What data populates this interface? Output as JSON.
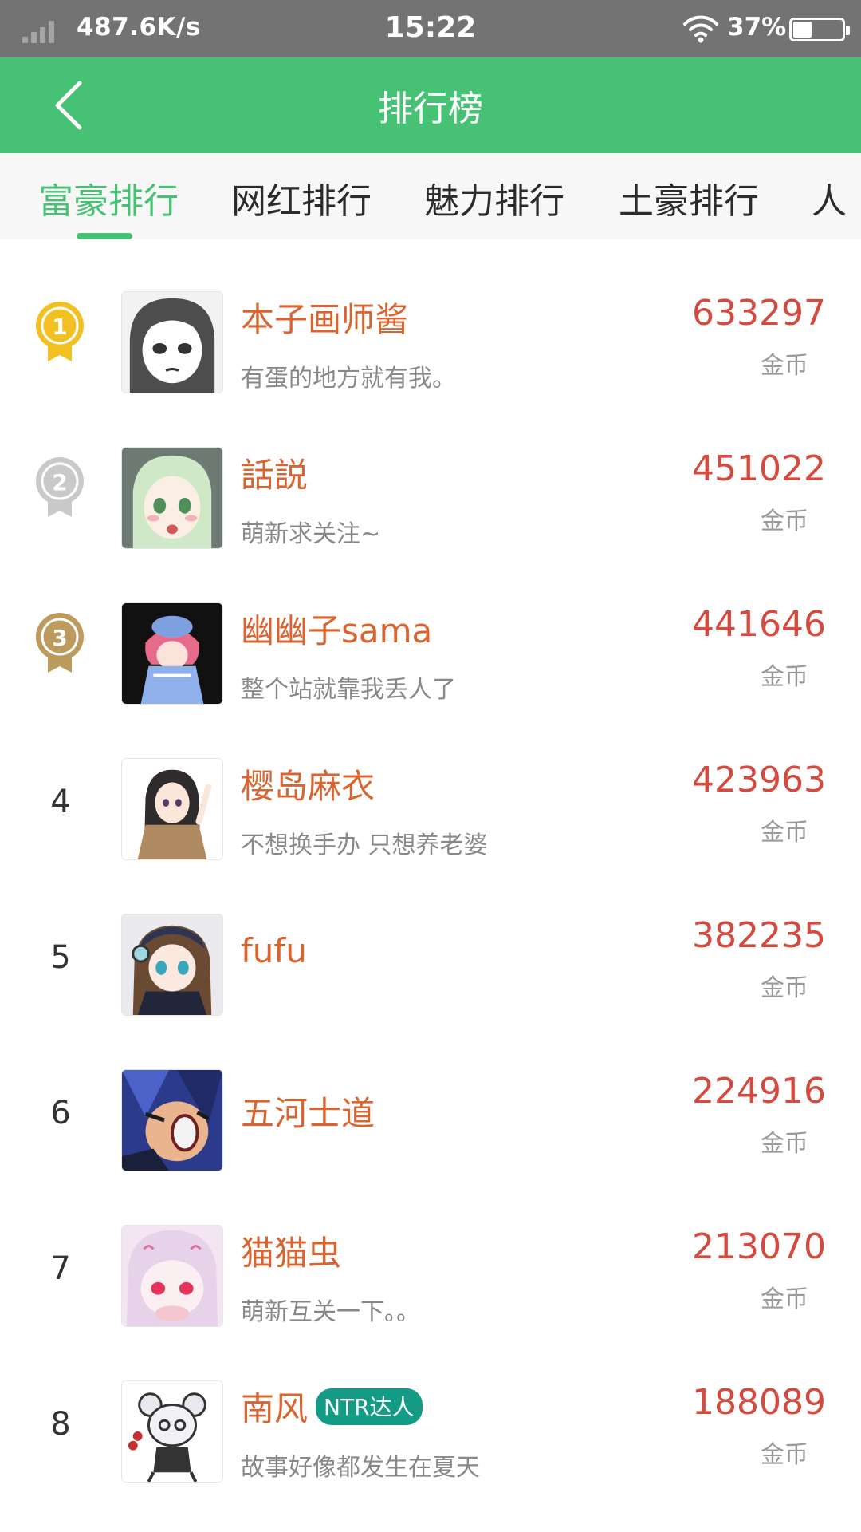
{
  "status_bar": {
    "net_speed": "487.6K/s",
    "time": "15:22",
    "battery": "37%"
  },
  "app_bar": {
    "back_icon": "chevron-left-icon",
    "title": "排行榜"
  },
  "tabs": [
    {
      "label": "富豪排行",
      "active": true
    },
    {
      "label": "网红排行",
      "active": false
    },
    {
      "label": "魅力排行",
      "active": false
    },
    {
      "label": "土豪排行",
      "active": false
    },
    {
      "label": "人",
      "active": false
    }
  ],
  "colors": {
    "primary": "#47c274",
    "name": "#d9642f",
    "coins": "#d44a3f",
    "gold": "#f2c022",
    "silver": "#c9c9c9",
    "bronze": "#bd9a5e",
    "badge": "#149b85"
  },
  "rankings": [
    {
      "rank": "1",
      "medal": "gold",
      "name": "本子画师酱",
      "badge": "",
      "motto": "有蛋的地方就有我。",
      "coins": "633297",
      "unit": "金币"
    },
    {
      "rank": "2",
      "medal": "silver",
      "name": "話説",
      "badge": "",
      "motto": "萌新求关注~",
      "coins": "451022",
      "unit": "金币"
    },
    {
      "rank": "3",
      "medal": "bronze",
      "name": "幽幽子sama",
      "badge": "",
      "motto": "整个站就靠我丢人了",
      "coins": "441646",
      "unit": "金币"
    },
    {
      "rank": "4",
      "medal": "",
      "name": "樱岛麻衣",
      "badge": "",
      "motto": "不想换手办 只想养老婆",
      "coins": "423963",
      "unit": "金币"
    },
    {
      "rank": "5",
      "medal": "",
      "name": "fufu",
      "badge": "",
      "motto": "",
      "coins": "382235",
      "unit": "金币"
    },
    {
      "rank": "6",
      "medal": "",
      "name": "五河士道",
      "badge": "",
      "motto": "",
      "coins": "224916",
      "unit": "金币"
    },
    {
      "rank": "7",
      "medal": "",
      "name": "猫猫虫",
      "badge": "",
      "motto": "萌新互关一下。。",
      "coins": "213070",
      "unit": "金币"
    },
    {
      "rank": "8",
      "medal": "",
      "name": "南风",
      "badge": "NTR达人",
      "motto": "故事好像都发生在夏天",
      "coins": "188089",
      "unit": "金币"
    }
  ]
}
